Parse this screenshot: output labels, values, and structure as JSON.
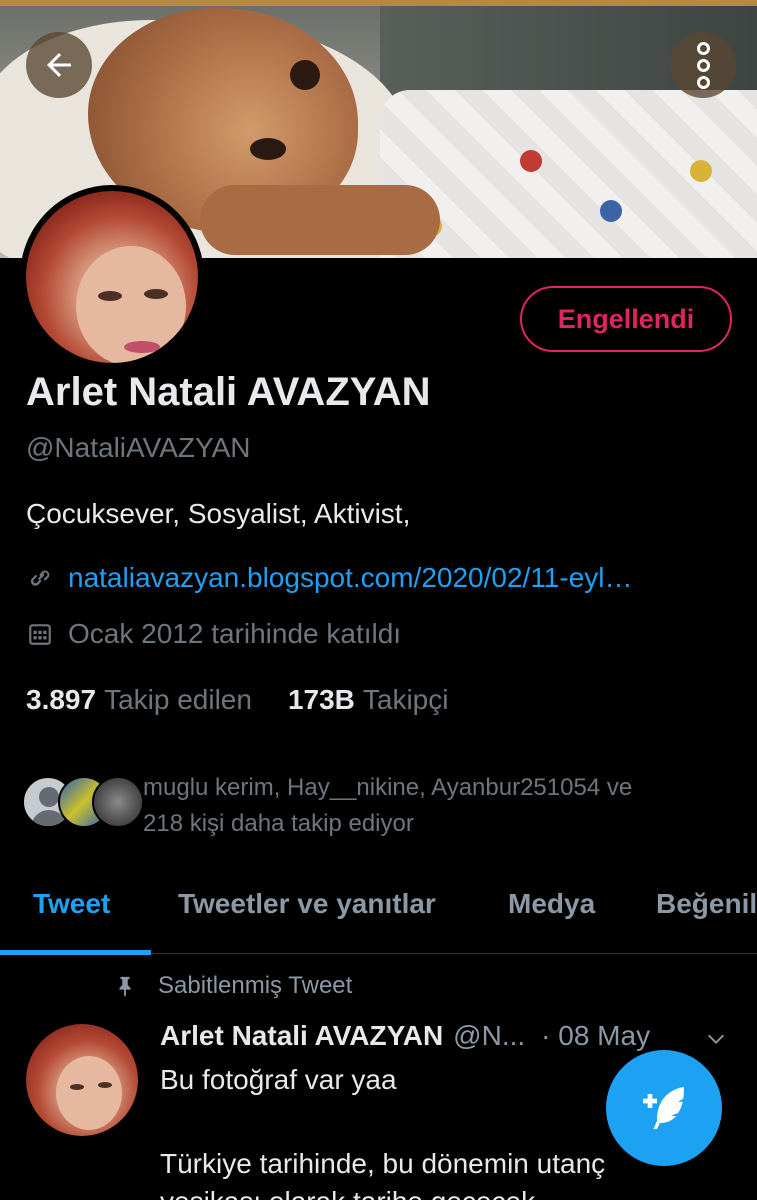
{
  "profile": {
    "name": "Arlet Natali AVAZYAN",
    "handle": "@NataliAVAZYAN",
    "bio": "Çocuksever, Sosyalist, Aktivist,",
    "link": "nataliavazyan.blogspot.com/2020/02/11-eyl…",
    "joined": "Ocak 2012 tarihinde katıldı",
    "blocked_label": "Engellendi",
    "following_count": "3.897",
    "following_label": "Takip edilen",
    "followers_count": "173B",
    "followers_label": "Takipçi",
    "followed_by_line1": "muglu kerim, Hay__nikine, Ayanbur251054 ve",
    "followed_by_line2": "218 kişi daha takip ediyor"
  },
  "tabs": [
    {
      "label": "Tweet",
      "active": true
    },
    {
      "label": "Tweetler ve yanıtlar",
      "active": false
    },
    {
      "label": "Medya",
      "active": false
    },
    {
      "label": "Beğenil",
      "active": false
    }
  ],
  "pinned": {
    "label": "Sabitlenmiş Tweet",
    "author": "Arlet Natali AVAZYAN",
    "handle": "@N...",
    "date": "· 08 May",
    "line1": "Bu fotoğraf var yaa",
    "line2": "Türkiye tarihinde, bu dönemin utanç",
    "line3": "vesikası olarak tarihe geçecek."
  },
  "icons": {
    "back": "arrow-left-icon",
    "more": "more-vertical-icon",
    "link": "link-icon",
    "calendar": "calendar-icon",
    "pin": "pin-icon",
    "chevron": "chevron-down-icon",
    "compose": "compose-tweet-icon"
  },
  "colors": {
    "accent": "#1da1f2",
    "blocked": "#e0245e",
    "background": "#000000",
    "secondary_text": "#6e767d"
  }
}
